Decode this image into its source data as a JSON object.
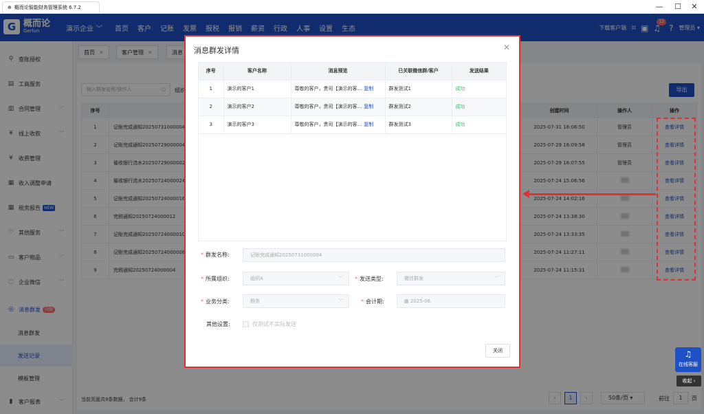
{
  "window": {
    "title": "概而论智能财务管理系统 6.7.2"
  },
  "nav": {
    "logo_mark": "G",
    "logo_cn": "概而论",
    "logo_en": "Gerlun",
    "enterprise": "演示企业",
    "menu": [
      "首页",
      "客户",
      "记账",
      "发票",
      "报税",
      "报销",
      "薪资",
      "行政",
      "人事",
      "设置",
      "生态"
    ],
    "download": "下载客户端",
    "notif_count": "12",
    "user": "管理员"
  },
  "sidebar": {
    "items": [
      {
        "label": "查账授权",
        "icon": "user-check-icon"
      },
      {
        "label": "工商服务",
        "icon": "business-icon"
      },
      {
        "label": "合同管理",
        "icon": "contract-icon"
      },
      {
        "label": "线上收款",
        "icon": "payment-icon"
      },
      {
        "label": "收费管理",
        "icon": "fee-icon"
      },
      {
        "label": "收入调整申请",
        "icon": "adjust-icon"
      },
      {
        "label": "税务报告",
        "icon": "report-icon",
        "tag": "NEW"
      },
      {
        "label": "其他服务",
        "icon": "heart-icon"
      },
      {
        "label": "客户物品",
        "icon": "box-icon"
      },
      {
        "label": "企业微信",
        "icon": "wechat-icon"
      },
      {
        "label": "消息群发",
        "icon": "broadcast-icon",
        "tag": "内测"
      }
    ],
    "sub": [
      "消息群发",
      "发送记录",
      "模板管理"
    ],
    "last": {
      "label": "客户报表",
      "icon": "chart-icon"
    }
  },
  "tabs": [
    "首页",
    "客户管理",
    "消息"
  ],
  "page": {
    "search_placeholder": "输入群发名称/操作人",
    "org_label": "组织",
    "export": "导出",
    "headers": {
      "seq": "序号",
      "name": "群发名称",
      "count": "数",
      "created": "创建时间",
      "operator": "操作人",
      "action": "操作"
    },
    "rows": [
      {
        "seq": "1",
        "name": "记账完成通知20250731000004",
        "created": "2025-07-31 16:06:50",
        "operator": "管理员",
        "action": "查看详情"
      },
      {
        "seq": "2",
        "name": "记账完成通知20250729000004",
        "created": "2025-07-29 16:09:58",
        "operator": "管理员",
        "action": "查看详情"
      },
      {
        "seq": "3",
        "name": "催收银行流水20250729000002",
        "created": "2025-07-29 16:07:55",
        "operator": "管理员",
        "action": "查看详情"
      },
      {
        "seq": "4",
        "name": "催收银行流水20250724000024",
        "created": "2025-07-24 15:06:56",
        "operator": "",
        "action": "查看详情"
      },
      {
        "seq": "5",
        "name": "记账完成通知20250724000016",
        "created": "2025-07-24 14:02:16",
        "operator": "",
        "action": "查看详情"
      },
      {
        "seq": "6",
        "name": "完税通知20250724000012",
        "created": "2025-07-24 13:38:30",
        "operator": "",
        "action": "查看详情"
      },
      {
        "seq": "7",
        "name": "记账完成通知20250724000010",
        "created": "2025-07-24 13:33:35",
        "operator": "",
        "action": "查看详情"
      },
      {
        "seq": "8",
        "name": "记账完成通知20250724000008",
        "created": "2025-07-24 11:27:11",
        "operator": "",
        "action": "查看详情"
      },
      {
        "seq": "9",
        "name": "完税通知20250724000004",
        "created": "2025-07-24 11:15:31",
        "operator": "",
        "action": "查看详情"
      }
    ],
    "footer": "当前页面共9条数据， 合计9条",
    "pager": {
      "current": "1",
      "size": "50条/页",
      "goto": "前往",
      "goto_val": "1",
      "page_unit": "页"
    }
  },
  "modal": {
    "title": "消息群发详情",
    "headers": [
      "序号",
      "客户名称",
      "消息预览",
      "已关联微信群/客户",
      "发送结果"
    ],
    "rows": [
      {
        "seq": "1",
        "customer": "演示的客户1",
        "preview": "尊敬的客户，贵司【演示的客...",
        "copy": "复制",
        "group": "群发测试1",
        "result": "成功"
      },
      {
        "seq": "2",
        "customer": "演示的客户2",
        "preview": "尊敬的客户，贵司【演示的客...",
        "copy": "复制",
        "group": "群发测试2",
        "result": "成功"
      },
      {
        "seq": "3",
        "customer": "演示的客户3",
        "preview": "尊敬的客户，贵司【演示的客...",
        "copy": "复制",
        "group": "群发测试3",
        "result": "成功"
      }
    ],
    "form": {
      "name_label": "群发名称:",
      "name_value": "记账完成通知20250731000004",
      "org_label": "所属组织:",
      "org_value": "组织A",
      "type_label": "发送类型:",
      "type_value": "微信群发",
      "cat_label": "业务分类:",
      "cat_value": "税务",
      "period_label": "会计期:",
      "period_value": "2025-06",
      "other_label": "其他设置:",
      "other_value": "仅测试不实际发送"
    },
    "close": "关闭"
  },
  "float": {
    "online": "在线客服",
    "fold": "收起"
  },
  "colors": {
    "primary": "#1e51c5",
    "highlight": "#e03030",
    "success": "#38c172"
  }
}
